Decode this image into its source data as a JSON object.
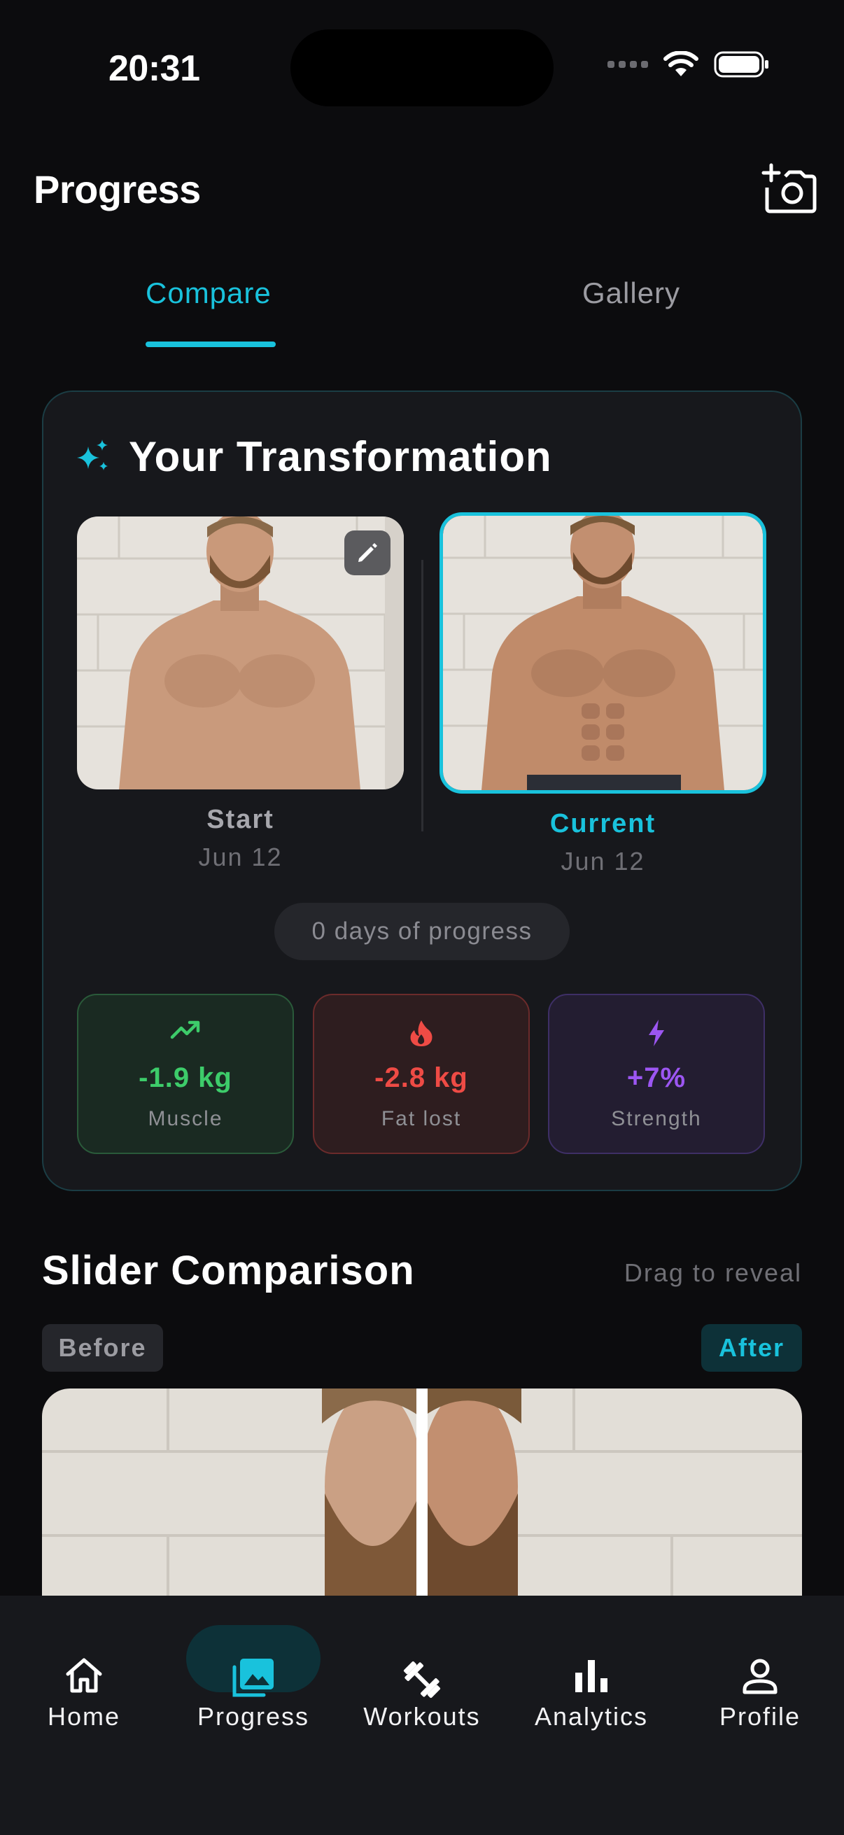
{
  "status_bar": {
    "time": "20:31"
  },
  "header": {
    "title": "Progress",
    "action_icon": "add-photo-icon"
  },
  "tabs": [
    {
      "label": "Compare",
      "active": true
    },
    {
      "label": "Gallery",
      "active": false
    }
  ],
  "transformation": {
    "title": "Your Transformation",
    "icon": "sparkle-icon",
    "start": {
      "label": "Start",
      "date": "Jun 12"
    },
    "current": {
      "label": "Current",
      "date": "Jun 12"
    },
    "days_progress": "0 days of progress",
    "stats": [
      {
        "value": "-1.9 kg",
        "label": "Muscle",
        "icon": "trending-up-icon",
        "color": "#3dcc6a"
      },
      {
        "value": "-2.8 kg",
        "label": "Fat lost",
        "icon": "flame-icon",
        "color": "#ee4b45"
      },
      {
        "value": "+7%",
        "label": "Strength",
        "icon": "bolt-icon",
        "color": "#9c56f2"
      }
    ]
  },
  "slider": {
    "title": "Slider Comparison",
    "hint": "Drag to reveal",
    "before_label": "Before",
    "after_label": "After"
  },
  "bottom_nav": [
    {
      "label": "Home",
      "icon": "home-icon",
      "active": false
    },
    {
      "label": "Progress",
      "icon": "photo-library-icon",
      "active": true
    },
    {
      "label": "Workouts",
      "icon": "dumbbell-icon",
      "active": false
    },
    {
      "label": "Analytics",
      "icon": "bar-chart-icon",
      "active": false
    },
    {
      "label": "Profile",
      "icon": "person-icon",
      "active": false
    }
  ],
  "colors": {
    "accent": "#19c2dc",
    "background": "#0c0c0e",
    "card": "#17181c"
  }
}
